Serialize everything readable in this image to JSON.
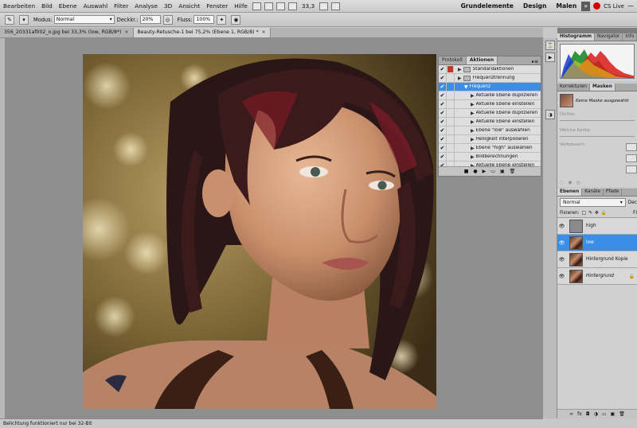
{
  "menubar": {
    "items": [
      "Bearbeiten",
      "Bild",
      "Ebene",
      "Auswahl",
      "Filter",
      "Analyse",
      "3D",
      "Ansicht",
      "Fenster",
      "Hilfe"
    ],
    "zoom": "33,3",
    "workspaces": [
      "Grundelemente",
      "Design",
      "Malen"
    ],
    "more": "»",
    "cslive": "CS Live"
  },
  "options": {
    "mode_label": "Modus:",
    "mode_value": "Normal",
    "opacity_label": "Deckkr.:",
    "opacity_value": "20%",
    "flow_label": "Fluss:",
    "flow_value": "100%"
  },
  "tabs": [
    {
      "label": "356_20331af002_o.jpg bei 33,3% (low, RGB/8*)",
      "close": "×"
    },
    {
      "label": "Beauty-Retusche-1 bei 75,2% (Ebene 1, RGB/8) *",
      "close": "×"
    }
  ],
  "status": {
    "text": "Belichtung funktioniert nur bei 32-Bit"
  },
  "actions_panel": {
    "tabs": [
      "Protokoll",
      "Aktionen"
    ],
    "rows": [
      {
        "label": "Standardaktionen",
        "check": "✔",
        "level": 0
      },
      {
        "label": "Frequenztrennung",
        "check": "✔",
        "level": 0
      },
      {
        "label": "Frequenz",
        "check": "✔",
        "level": 1,
        "selected": true
      },
      {
        "label": "Aktuelle Ebene duplizieren",
        "check": "✔",
        "level": 2
      },
      {
        "label": "Aktuelle Ebene einstellen",
        "check": "✔",
        "level": 2
      },
      {
        "label": "Aktuelle Ebene duplizieren",
        "check": "✔",
        "level": 2
      },
      {
        "label": "Aktuelle Ebene einstellen",
        "check": "✔",
        "level": 2
      },
      {
        "label": "Ebene \"low\" auswählen",
        "check": "✔",
        "level": 2
      },
      {
        "label": "Helligkeit interpolieren",
        "check": "✔",
        "level": 2
      },
      {
        "label": "Ebene \"high\" auswählen",
        "check": "✔",
        "level": 2
      },
      {
        "label": "Bildberechnungen",
        "check": "✔",
        "level": 2
      },
      {
        "label": "Aktuelle Ebene einstellen",
        "check": "✔",
        "level": 2
      }
    ]
  },
  "histogram_panel": {
    "tabs": [
      "Histogramm",
      "Navigator",
      "Info"
    ]
  },
  "masks_panel": {
    "tabs": [
      "Korrekturen",
      "Masken"
    ],
    "no_mask": "Keine Maske ausgewählt",
    "density": "Dichte:",
    "feather": "Weiche Kante:",
    "refine": "Verbessern:"
  },
  "layers_panel": {
    "tabs": [
      "Ebenen",
      "Kanäle",
      "Pfade"
    ],
    "blend": "Normal",
    "blend_right": "Dec",
    "lock_label": "Fixieren:",
    "lock_right": "Fl",
    "layers": [
      {
        "name": "high",
        "thumb": "gray",
        "italic": false
      },
      {
        "name": "low",
        "thumb": "photo",
        "italic": false,
        "selected": true
      },
      {
        "name": "Hintergrund Kopie",
        "thumb": "photo",
        "italic": false
      },
      {
        "name": "Hintergrund",
        "thumb": "photo",
        "italic": true
      }
    ]
  },
  "colors": {
    "selection": "#3a8ee6",
    "panel": "#d0d0d0"
  }
}
